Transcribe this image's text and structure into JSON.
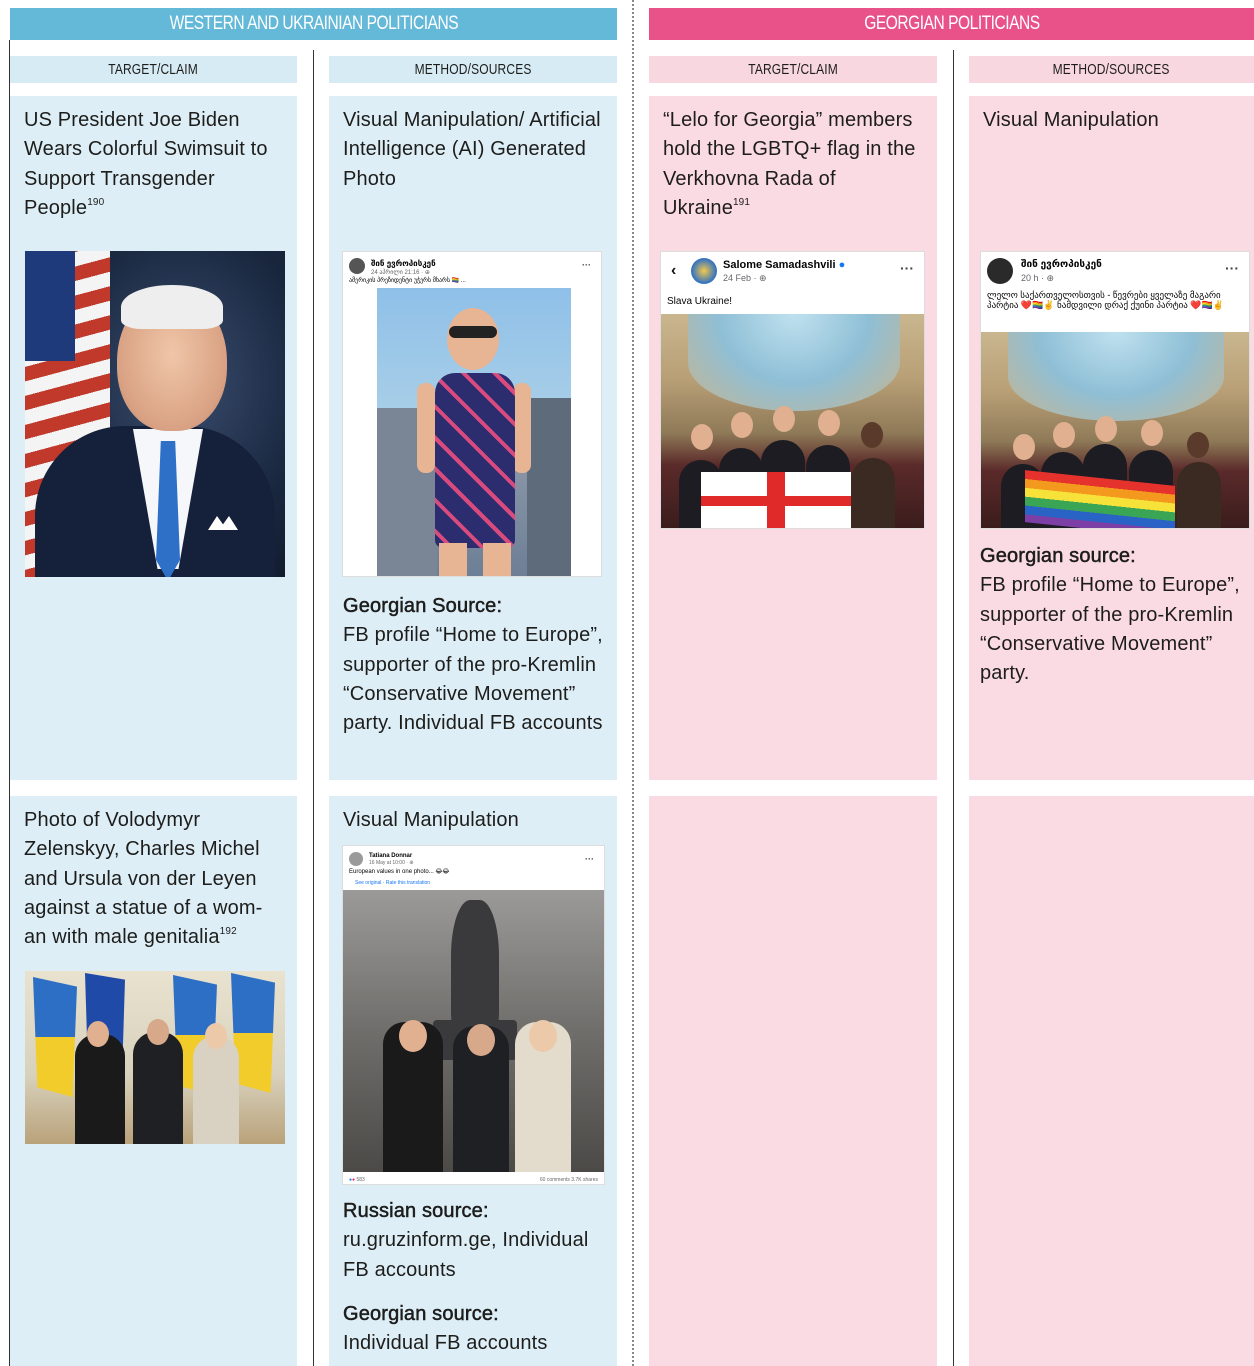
{
  "banners": {
    "west": "WESTERN AND UKRAINIAN POLITICIANS",
    "georgian": "GEORGIAN POLITICIANS"
  },
  "headers": {
    "target_claim": "TARGET/CLAIM",
    "method_sources": "METHOD/SOURCES"
  },
  "row1": {
    "west_claim": "US President Joe Biden Wears Colorful Swimsuit to Support Transgender People",
    "west_claim_ref": "190",
    "west_method": "Visual Manipulation/ Artificial Intelligence (AI) Generated Photo",
    "west_source_label": "Georgian Source:",
    "west_source_text": "FB profile “Home to Europe”, supporter of the pro-Kremlin “Conservative Movement” party. Individual FB accounts",
    "geo_claim": "“Lelo for Georgia” members hold the LGBTQ+ flag in the Verkhovna Rada of Ukraine",
    "geo_claim_ref": "191",
    "geo_method": "Visual Manipulation",
    "geo_source_label": "Georgian source:",
    "geo_source_text": "FB profile “Home to Europe”, supporter of the pro-Kremlin “Conservative Movement” party."
  },
  "row2": {
    "west_claim": "Photo of Volodymyr Zelenskyy, Charles Michel and Ursula von der Leyen against a statue of a wom-an with male genitalia",
    "west_claim_ref": "192",
    "west_method": "Visual Manipulation",
    "russian_source_label": "Russian source:",
    "russian_source_text": "ru.gruzinform.ge, Individual FB accounts",
    "georgian_source_label": "Georgian source:",
    "georgian_source_text": "Individual FB accounts"
  },
  "posts": {
    "swimsuit_post": {
      "name": "შინ ევროპისკენ",
      "meta": "24 აპრილი 21:16 · ⊕",
      "text": "ამერიკის პრეზიდენტი უჭერს მხარს 🏳️‍🌈 ..."
    },
    "salome_post": {
      "name": "Salome Samadashvili",
      "meta": "24 Feb · ⊕",
      "text": "Slava Ukraine!"
    },
    "home_europe_post": {
      "name": "შინ ევროპისკენ",
      "meta": "20 h · ⊕",
      "text": "ლელო საქართველოსთვის - წევრები ყველაზე მაგარი პარტია ❤️🏳️‍🌈✌️ ნამდვილი დრაქ ქუინი პარტია ❤️🏳️‍🌈✌️"
    },
    "statue_post": {
      "name": "Tatiana Donnar",
      "meta": "16 May at 10:00 · ⊕",
      "text": "European values in one photo... 😂😂",
      "translate": "See original · Rate this translation",
      "reactions": "583",
      "stats": "60 comments 3.7K shares"
    }
  },
  "colors": {
    "west_banner": "#64b8d8",
    "georgian_banner": "#e95288",
    "west_cell": "#ddeef7",
    "georgian_cell": "#fadbe3"
  }
}
